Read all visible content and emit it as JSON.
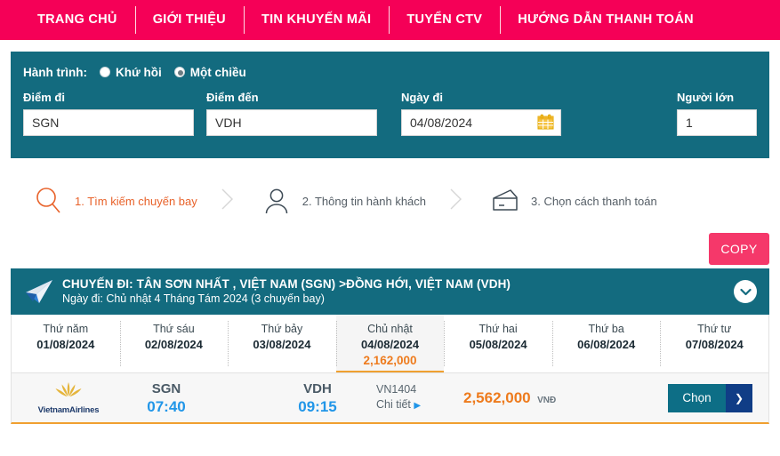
{
  "nav": {
    "items": [
      {
        "label": "TRANG CHỦ"
      },
      {
        "label": "GIỚI THIỆU"
      },
      {
        "label": "TIN KHUYẾN MÃI"
      },
      {
        "label": "TUYỂN CTV"
      },
      {
        "label": "HƯỚNG DẪN THANH TOÁN"
      }
    ]
  },
  "search": {
    "journey_label": "Hành trình:",
    "radio_round_trip": "Khứ hồi",
    "radio_one_way": "Một chiều",
    "selected_journey": "Một chiều",
    "from_label": "Điểm đi",
    "from_value": "SGN",
    "to_label": "Điểm đến",
    "to_value": "VDH",
    "date_label": "Ngày đi",
    "date_value": "04/08/2024",
    "pax_label": "Người lớn",
    "pax_value": "1",
    "calendar_icon": "calendar-icon"
  },
  "steps": [
    {
      "icon": "search-icon",
      "label": "1. Tìm kiếm chuyến bay",
      "active": true
    },
    {
      "icon": "person-icon",
      "label": "2. Thông tin hành khách",
      "active": false
    },
    {
      "icon": "wallet-icon",
      "label": "3. Chọn cách thanh toán",
      "active": false
    }
  ],
  "copy_button": {
    "label": "COPY"
  },
  "trip": {
    "plane_icon": "paper-plane-icon",
    "title": "CHUYẾN ĐI: TÂN SƠN NHẤT , VIỆT NAM (SGN) >ĐỒNG HỚI, VIỆT NAM (VDH)",
    "subtitle": "Ngày đi: Chủ nhật 4 Tháng Tám 2024 (3 chuyến bay)",
    "collapse_icon": "chevron-down-icon"
  },
  "date_strip": [
    {
      "dow": "Thứ năm",
      "date": "01/08/2024",
      "price": "",
      "selected": false
    },
    {
      "dow": "Thứ sáu",
      "date": "02/08/2024",
      "price": "",
      "selected": false
    },
    {
      "dow": "Thứ bảy",
      "date": "03/08/2024",
      "price": "",
      "selected": false
    },
    {
      "dow": "Chủ nhật",
      "date": "04/08/2024",
      "price": "2,162,000",
      "selected": true
    },
    {
      "dow": "Thứ hai",
      "date": "05/08/2024",
      "price": "",
      "selected": false
    },
    {
      "dow": "Thứ ba",
      "date": "06/08/2024",
      "price": "",
      "selected": false
    },
    {
      "dow": "Thứ tư",
      "date": "07/08/2024",
      "price": "",
      "selected": false
    }
  ],
  "flight": {
    "airline_name": "VietnamAirlines",
    "airline_logo": "lotus-icon",
    "depart_code": "SGN",
    "depart_time": "07:40",
    "arrive_code": "VDH",
    "arrive_time": "09:15",
    "flight_no": "VN1404",
    "detail_label": "Chi tiết",
    "price": "2,562,000",
    "currency": "VNĐ",
    "choose_label": "Chọn",
    "choose_arrow": "chevron-right-icon"
  },
  "colors": {
    "nav_pink": "#f50057",
    "panel_teal": "#136b7f",
    "accent_orange": "#ee7b1d",
    "copy_pink": "#f5386a",
    "time_blue": "#2196e8"
  }
}
